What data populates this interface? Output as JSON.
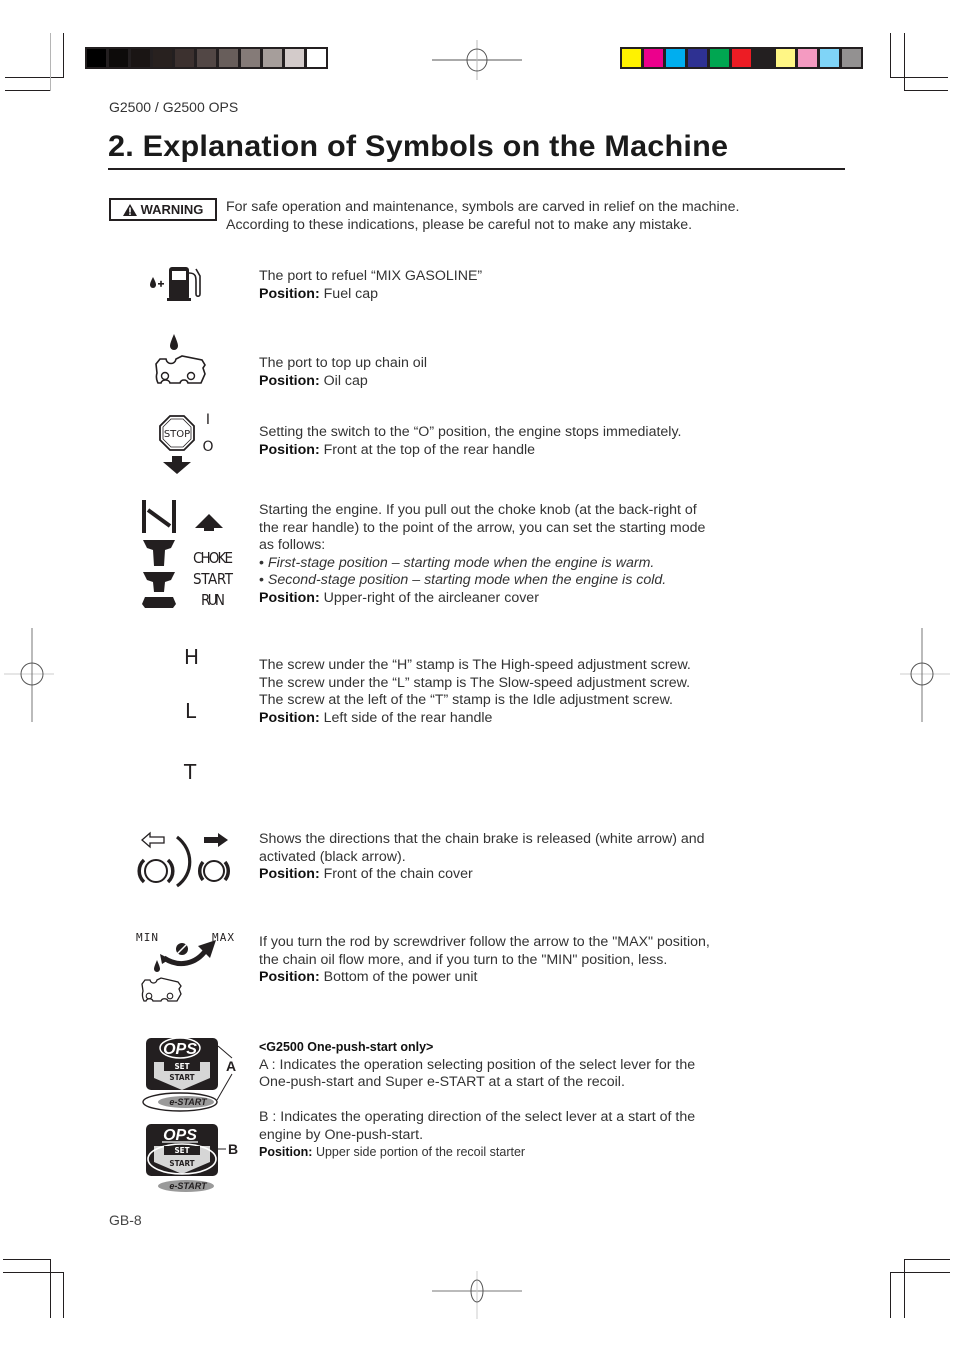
{
  "header": {
    "running_head": "G2500 / G2500 OPS",
    "gray_swatches": [
      "#000000",
      "#0d0b0a",
      "#1a1514",
      "#28211f",
      "#3c312f",
      "#524745",
      "#685e5b",
      "#857b78",
      "#a69e9b",
      "#d3cbca",
      "#ffffff"
    ],
    "color_swatches": [
      "#fff200",
      "#ec008c",
      "#00aeef",
      "#2e3192",
      "#00a651",
      "#ed1c24",
      "#231f20",
      "#fff685",
      "#f49ac1",
      "#7fd4f7",
      "#939191"
    ]
  },
  "page": {
    "title": "2. Explanation of Symbols on the Machine",
    "warning_label": "WARNING",
    "intro_line1": "For safe operation and maintenance, symbols are carved in relief on the machine.",
    "intro_line2": "According to these indications, please be careful not to make any mistake.",
    "position_label": "Position:",
    "folio": "GB-8"
  },
  "symbols": [
    {
      "icon": "fuel-pump-icon",
      "lines": [
        "The port to refuel “MIX GASOLINE”"
      ],
      "position": "Fuel cap"
    },
    {
      "icon": "chain-oil-icon",
      "lines": [
        "The port to top up chain oil"
      ],
      "position": "Oil cap"
    },
    {
      "icon": "stop-switch-icon",
      "glyph_labels": {
        "stop": "STOP",
        "on": "I",
        "off": "O"
      },
      "lines": [
        "Setting the switch to the “O” position, the engine stops immediately."
      ],
      "position": "Front at the top of the rear handle"
    },
    {
      "icon": "choke-icon",
      "glyph_labels": [
        "CHOKE",
        "START",
        "RUN"
      ],
      "lines": [
        "Starting the engine. If you pull out the choke knob (at the back-right of",
        "the rear handle) to the point of the arrow, you can set the starting mode",
        "as follows:"
      ],
      "bullets": [
        "First-stage position – starting mode when the engine is warm.",
        "Second-stage position – starting mode when the engine is cold."
      ],
      "position": "Upper-right of the aircleaner cover"
    },
    {
      "icon": "carburetor-screws-icon",
      "glyph_labels": [
        "H",
        "L",
        "T"
      ],
      "lines": [
        "The screw under the “H” stamp is The High-speed adjustment screw.",
        "The screw under the “L” stamp is The Slow-speed adjustment screw.",
        "The screw at the left of the “T” stamp is the Idle adjustment screw."
      ],
      "position": "Left side of the rear handle"
    },
    {
      "icon": "chain-brake-icon",
      "lines": [
        "Shows the directions that the chain brake is released (white arrow) and",
        "activated (black arrow)."
      ],
      "position": "Front of the chain cover"
    },
    {
      "icon": "oil-adjust-icon",
      "glyph_labels": {
        "min": "MIN",
        "max": "MAX"
      },
      "lines": [
        "If you turn the rod by screwdriver follow the arrow to the \"MAX\" position,",
        "the chain oil flow more, and if you turn to the \"MIN\" position, less."
      ],
      "position": "Bottom of the power unit"
    },
    {
      "icon": "ops-lever-icon",
      "glyph_labels": {
        "ops": "OPS",
        "set": "SET",
        "start": "START",
        "estart": "e-START",
        "a": "A",
        "b": "B"
      },
      "heading": "<G2500 One-push-start only>",
      "lines_a": [
        "A : Indicates the operation selecting position of the select lever for the",
        "One-push-start and Super e-START at a start of the recoil."
      ],
      "lines_b": [
        "B : Indicates the operating direction of the select lever at a start of the",
        "engine by One-push-start."
      ],
      "position": "Upper side portion of the recoil starter"
    }
  ]
}
